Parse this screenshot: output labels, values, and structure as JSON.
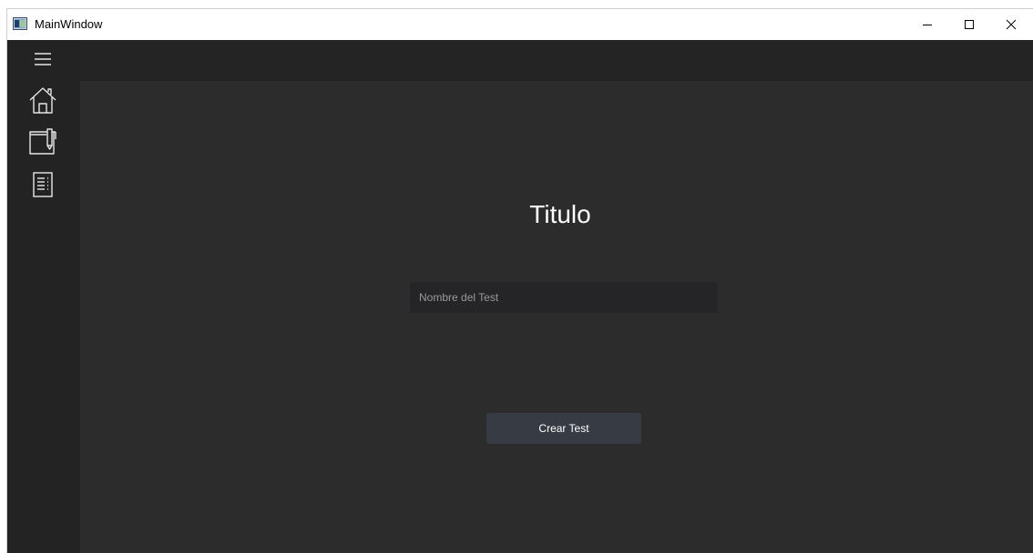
{
  "window": {
    "title": "MainWindow",
    "icons": {
      "app": "app-window-icon",
      "minimize": "minimize-icon",
      "maximize": "maximize-icon",
      "close": "close-icon"
    }
  },
  "sidebar": {
    "items": [
      {
        "icon": "hamburger-menu-icon"
      },
      {
        "icon": "home-icon"
      },
      {
        "icon": "notebook-pen-icon"
      },
      {
        "icon": "document-list-icon"
      }
    ]
  },
  "main": {
    "title": "Titulo",
    "test_name_input": {
      "value": "",
      "placeholder": "Nombre del Test"
    },
    "create_button_label": "Crear Test"
  },
  "colors": {
    "background": "#2c2c2c",
    "sidebar": "#232323",
    "topbar": "#242424",
    "input": "#252528",
    "button": "#373b44",
    "text": "#ffffff"
  }
}
